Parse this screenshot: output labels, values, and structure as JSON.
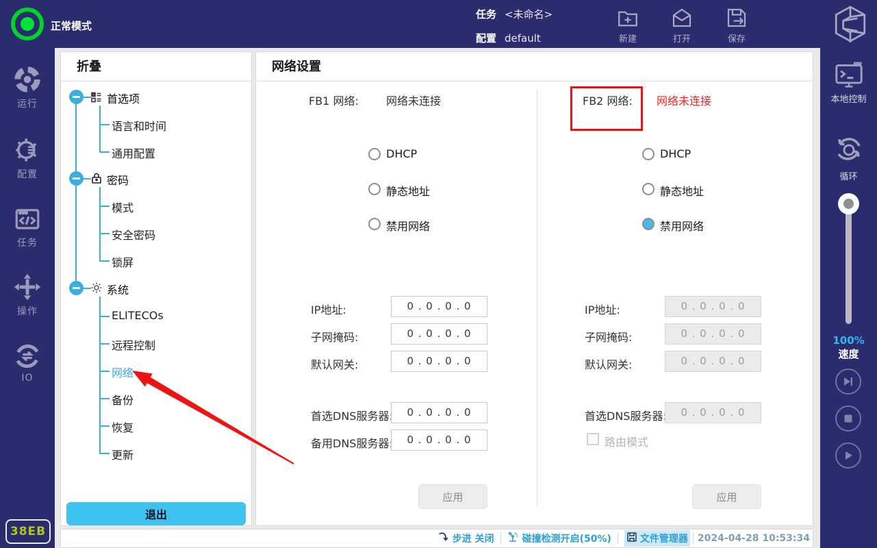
{
  "topbar": {
    "mode_label": "正常模式",
    "task_label": "任务",
    "task_value": "<未命名>",
    "config_label": "配置",
    "config_value": "default",
    "new_label": "新建",
    "open_label": "打开",
    "save_label": "保存"
  },
  "left_nav": {
    "items": [
      {
        "label": "运行"
      },
      {
        "label": "配置"
      },
      {
        "label": "任务"
      },
      {
        "label": "操作"
      },
      {
        "label": "IO"
      }
    ],
    "badge": "38EB"
  },
  "tree_panel": {
    "header": "折叠",
    "nodes": [
      {
        "label": "首选项",
        "icon": "preferences-icon",
        "children": [
          "语言和时间",
          "通用配置"
        ]
      },
      {
        "label": "密码",
        "icon": "lock-icon",
        "children": [
          "模式",
          "安全密码",
          "锁屏"
        ]
      },
      {
        "label": "系统",
        "icon": "gear-icon",
        "children": [
          "ELITECOs",
          "远程控制",
          "网络",
          "备份",
          "恢复",
          "更新"
        ]
      }
    ],
    "selected_child": "网络",
    "exit_label": "退出"
  },
  "main": {
    "title": "网络设置",
    "fb1": {
      "name_label": "FB1 网络:",
      "status": "网络未连接",
      "radios": [
        {
          "label": "DHCP",
          "checked": false
        },
        {
          "label": "静态地址",
          "checked": false
        },
        {
          "label": "禁用网络",
          "checked": false
        }
      ],
      "fields": [
        {
          "label": "IP地址:",
          "value": "0 . 0 . 0 . 0"
        },
        {
          "label": "子网掩码:",
          "value": "0 . 0 . 0 . 0"
        },
        {
          "label": "默认网关:",
          "value": "0 . 0 . 0 . 0"
        },
        {
          "label": "首选DNS服务器:",
          "value": "0 . 0 . 0 . 0"
        },
        {
          "label": "备用DNS服务器:",
          "value": "0 . 0 . 0 . 0"
        }
      ],
      "apply_label": "应用"
    },
    "fb2": {
      "name_label": "FB2 网络:",
      "status": "网络未连接",
      "radios": [
        {
          "label": "DHCP",
          "checked": false
        },
        {
          "label": "静态地址",
          "checked": false
        },
        {
          "label": "禁用网络",
          "checked": true
        }
      ],
      "fields": [
        {
          "label": "IP地址:",
          "value": "0 . 0 . 0 . 0"
        },
        {
          "label": "子网掩码:",
          "value": "0 . 0 . 0 . 0"
        },
        {
          "label": "默认网关:",
          "value": "0 . 0 . 0 . 0"
        },
        {
          "label": "首选DNS服务器:",
          "value": "0 . 0 . 0 . 0"
        }
      ],
      "route_mode_label": "路由模式",
      "route_mode_checked": false,
      "apply_label": "应用"
    }
  },
  "right_nav": {
    "local_control_label": "本地控制",
    "loop_label": "循环",
    "speed_percent": "100%",
    "speed_label": "速度"
  },
  "statusbar": {
    "step_label": "步进 关闭",
    "collision_label": "碰撞检测开启(50%)",
    "file_manager_label": "文件管理器",
    "timestamp": "2024-04-28 10:53:34"
  },
  "colors": {
    "navy": "#2b2c6e",
    "accent_blue": "#3aaede",
    "selected_radio": "#45b9e8",
    "annotation_red": "#e91313",
    "error_red": "#f32222",
    "status_blue": "#2e9fd4",
    "exit_button": "#3ec2ef",
    "badge_text": "#b3c41d",
    "speed_cyan": "#2fb6f3"
  }
}
